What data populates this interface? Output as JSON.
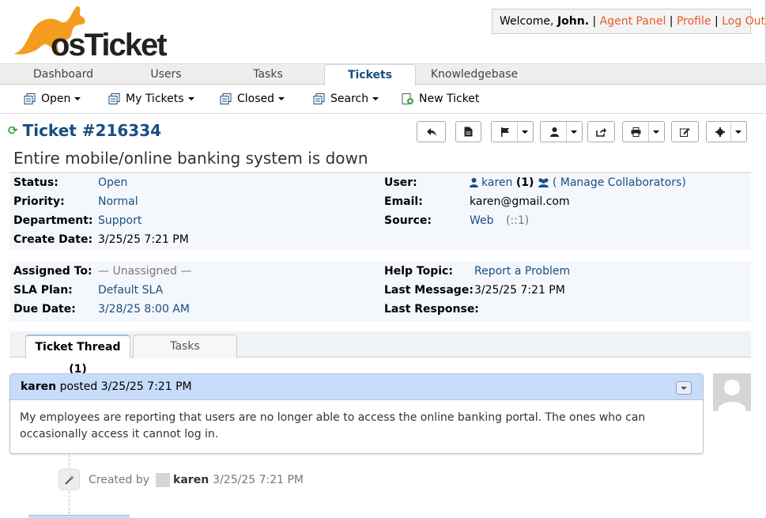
{
  "app": {
    "name": "osTicket"
  },
  "header": {
    "welcome_prefix": "Welcome, ",
    "user_name": "John.",
    "agent_panel": "Agent Panel",
    "profile": "Profile",
    "logout": "Log Out",
    "separator": " | "
  },
  "nav": {
    "tabs": [
      {
        "label": "Dashboard"
      },
      {
        "label": "Users"
      },
      {
        "label": "Tasks"
      },
      {
        "label": "Tickets",
        "active": true
      },
      {
        "label": "Knowledgebase"
      }
    ]
  },
  "subnav": {
    "items": [
      {
        "label": "Open"
      },
      {
        "label": "My Tickets"
      },
      {
        "label": "Closed"
      },
      {
        "label": "Search"
      },
      {
        "label": "New Ticket"
      }
    ]
  },
  "ticket": {
    "number": "Ticket #216334",
    "subject": "Entire mobile/online banking system is down",
    "status_label": "Status:",
    "status": "Open",
    "priority_label": "Priority:",
    "priority": "Normal",
    "department_label": "Department:",
    "department": "Support",
    "create_date_label": "Create Date:",
    "create_date": "3/25/25 7:21 PM",
    "user_label": "User:",
    "user": "karen",
    "user_count": "(1)",
    "collaborators": "( Manage Collaborators)",
    "email_label": "Email:",
    "email": "karen@gmail.com",
    "source_label": "Source:",
    "source": "Web",
    "source_ip": "(::1)",
    "assigned_label": "Assigned To:",
    "assigned": "— Unassigned —",
    "sla_label": "SLA Plan:",
    "sla": "Default SLA",
    "due_label": "Due Date:",
    "due": "3/28/25 8:00 AM",
    "help_topic_label": "Help Topic:",
    "help_topic": "Report a Problem",
    "last_message_label": "Last Message:",
    "last_message": "3/25/25 7:21 PM",
    "last_response_label": "Last Response:"
  },
  "thread_tabs": {
    "thread": "Ticket Thread (1)",
    "tasks": "Tasks"
  },
  "message": {
    "author": "karen",
    "posted": " posted 3/25/25 7:21 PM",
    "body": "My employees are reporting that users are no longer able to access the online banking portal. The ones who can occasionally access it cannot log in."
  },
  "event": {
    "created_by": "Created by",
    "author": "karen",
    "date": "3/25/25 7:21 PM"
  },
  "colors": {
    "brand": "#e65b27",
    "link": "#184e81",
    "message_header": "#c6dcfa"
  }
}
